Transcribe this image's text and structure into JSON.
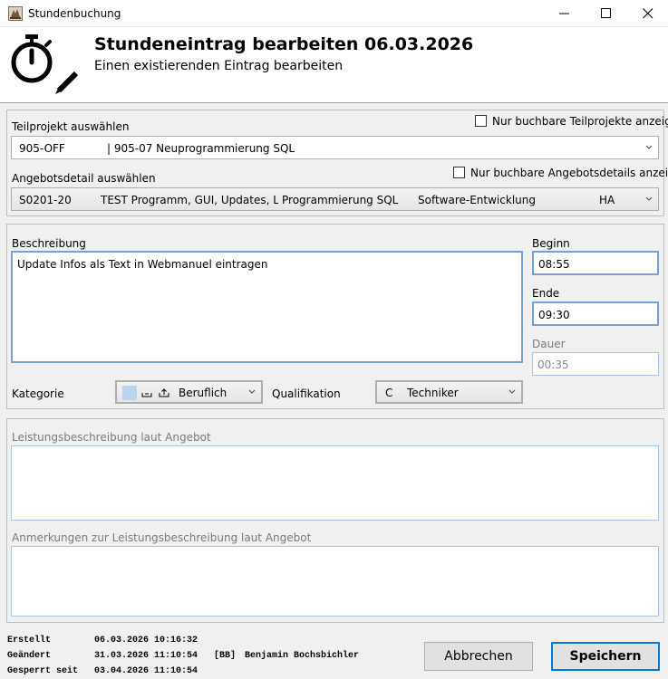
{
  "window": {
    "title": "Stundenbuchung"
  },
  "header": {
    "title": "Stundeneintrag bearbeiten 06.03.2026",
    "subtitle": "Einen existierenden Eintrag bearbeiten"
  },
  "teilprojekt": {
    "label": "Teilprojekt auswählen",
    "checkbox_label": "Nur buchbare Teilprojekte anzeigen",
    "code": "905-OFF",
    "name": "| 905-07 Neuprogrammierung SQL"
  },
  "angebotsdetail": {
    "label": "Angebotsdetail auswählen",
    "checkbox_label": "Nur buchbare Angebotsdetails anzeigen",
    "code": "S0201-20",
    "desc": "TEST Programm, GUI, Updates, Lize",
    "task": "Programmierung SQL",
    "category": "Software-Entwicklung",
    "unit": "HA"
  },
  "beschreibung": {
    "label": "Beschreibung",
    "value": "Update Infos als Text in Webmanuel eintragen"
  },
  "times": {
    "beginn_label": "Beginn",
    "beginn": "08:55",
    "ende_label": "Ende",
    "ende": "09:30",
    "dauer_label": "Dauer",
    "dauer": "00:35"
  },
  "kategorie": {
    "label": "Kategorie",
    "value": "Beruflich",
    "swatch_color": "#b9d3f0"
  },
  "qualifikation": {
    "label": "Qualifikation",
    "code": "C",
    "value": "Techniker"
  },
  "leistung": {
    "label": "Leistungsbeschreibung laut Angebot",
    "anmerkung_label": "Anmerkungen zur Leistungsbeschreibung laut Angebot"
  },
  "audit": {
    "erstellt_label": "Erstellt",
    "erstellt": "06.03.2026 10:16:32",
    "geaendert_label": "Geändert",
    "geaendert": "31.03.2026 11:10:54",
    "geaendert_by_code": "[BB]",
    "geaendert_by_name": "Benjamin Bochsbichler",
    "gesperrt_label": "Gesperrt seit",
    "gesperrt": "03.04.2026 11:10:54"
  },
  "buttons": {
    "cancel": "Abbrechen",
    "save": "Speichern"
  }
}
